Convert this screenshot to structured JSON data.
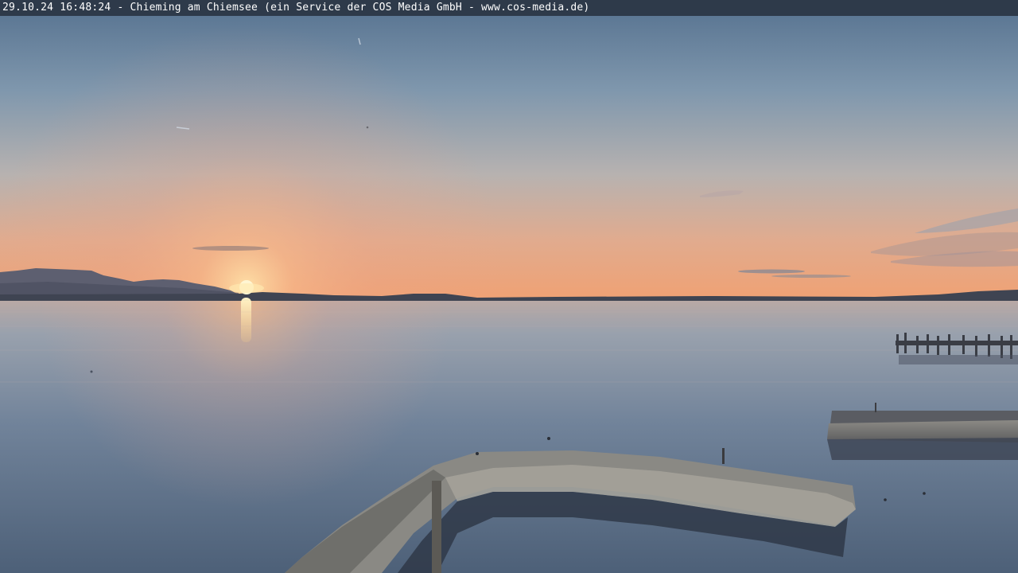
{
  "caption": {
    "text": "29.10.24 16:48:24 - Chieming am Chiemsee (ein Service der COS Media GmbH - www.cos-media.de)"
  },
  "colors": {
    "caption_bar": "#2e3a4a",
    "sky_top": "#5e7b98",
    "sky_horizon": "#f0a070",
    "water": "#5d7188",
    "sun": "#fff2c0"
  }
}
